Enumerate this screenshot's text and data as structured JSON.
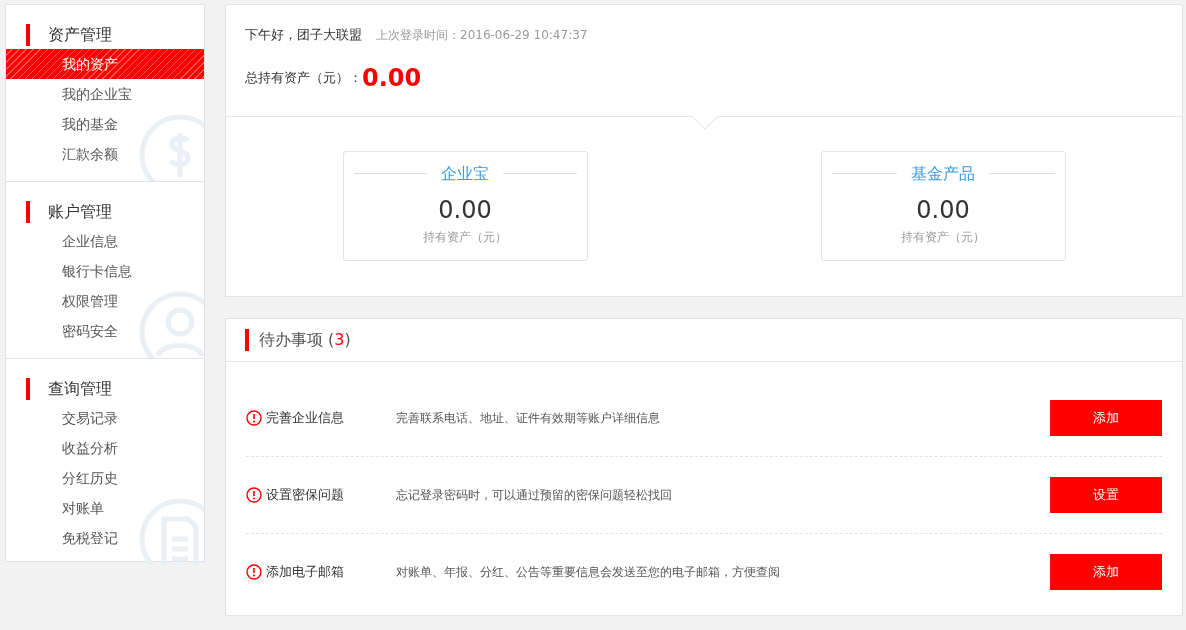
{
  "sidebar": {
    "sections": [
      {
        "heading": "资产管理",
        "items": [
          {
            "label": "我的资产",
            "selected": true
          },
          {
            "label": "我的企业宝",
            "selected": false
          },
          {
            "label": "我的基金",
            "selected": false
          },
          {
            "label": "汇款余额",
            "selected": false
          }
        ]
      },
      {
        "heading": "账户管理",
        "items": [
          {
            "label": "企业信息",
            "selected": false
          },
          {
            "label": "银行卡信息",
            "selected": false
          },
          {
            "label": "权限管理",
            "selected": false
          },
          {
            "label": "密码安全",
            "selected": false
          }
        ]
      },
      {
        "heading": "查询管理",
        "items": [
          {
            "label": "交易记录",
            "selected": false
          },
          {
            "label": "收益分析",
            "selected": false
          },
          {
            "label": "分红历史",
            "selected": false
          },
          {
            "label": "对账单",
            "selected": false
          },
          {
            "label": "免税登记",
            "selected": false
          }
        ]
      }
    ]
  },
  "summary": {
    "greeting": "下午好，团子大联盟",
    "last_login": "上次登录时间：2016-06-29 10:47:37",
    "total_label": "总持有资产（元）：",
    "total_value": "0.00",
    "products": [
      {
        "title": "企业宝",
        "value": "0.00",
        "caption": "持有资产（元）"
      },
      {
        "title": "基金产品",
        "value": "0.00",
        "caption": "持有资产（元）"
      }
    ]
  },
  "todo": {
    "title": "待办事项",
    "count_open": "(",
    "count": "3",
    "count_close": ")",
    "items": [
      {
        "title": "完善企业信息",
        "description": "完善联系电话、地址、证件有效期等账户详细信息",
        "action": "添加"
      },
      {
        "title": "设置密保问题",
        "description": "忘记登录密码时，可以通过预留的密保问题轻松找回",
        "action": "设置"
      },
      {
        "title": "添加电子邮箱",
        "description": "对账单、年报、分红、公告等重要信息会发送至您的电子邮箱，方便查阅",
        "action": "添加"
      }
    ]
  }
}
